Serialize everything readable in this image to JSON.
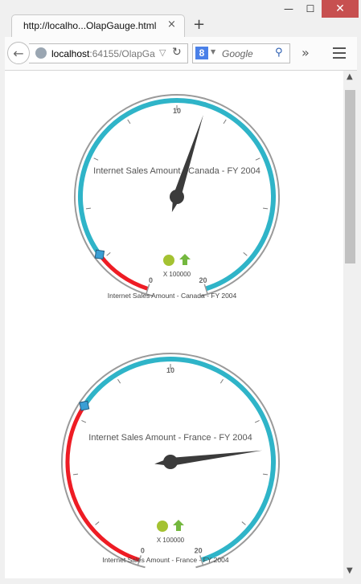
{
  "window": {
    "minimize_glyph": "—",
    "maximize_glyph": "☐",
    "close_glyph": "✕"
  },
  "tab": {
    "title": "http://localho...OlapGauge.html",
    "close_glyph": "×",
    "new_tab_glyph": "+"
  },
  "navbar": {
    "url_host": "localhost",
    "url_rest": ":64155/OlapGa",
    "search_placeholder": "Google",
    "search_engine_letter": "8",
    "overflow_glyph": "»"
  },
  "gauges": [
    {
      "title": "Internet Sales Amount - Canada - FY 2004",
      "caption": "Internet Sales Amount - Canada - FY 2004",
      "min_label": "0",
      "mid_label": "10",
      "max_label": "20",
      "multiplier": "X 100000",
      "range_min": 0,
      "range_max": 20,
      "value": 11.1,
      "marker_value": 2.2,
      "red_range": [
        0,
        2.2
      ],
      "teal_range": [
        2.2,
        20
      ]
    },
    {
      "title": "Internet Sales Amount - France - FY 2004",
      "caption": "Internet Sales Amount - France - FY 2004",
      "min_label": "0",
      "mid_label": "10",
      "max_label": "20",
      "multiplier": "X 100000",
      "range_min": 0,
      "range_max": 20,
      "value": 15.1,
      "marker_value": 6.5,
      "red_range": [
        0,
        6.5
      ],
      "teal_range": [
        6.5,
        20
      ]
    }
  ],
  "colors": {
    "red": "#ee1c24",
    "teal": "#2fb4c8",
    "needle": "#3b3b3b",
    "status_dot": "#a4c232",
    "trend_arrow": "#74b83f",
    "marker": "#3a9ed4"
  }
}
